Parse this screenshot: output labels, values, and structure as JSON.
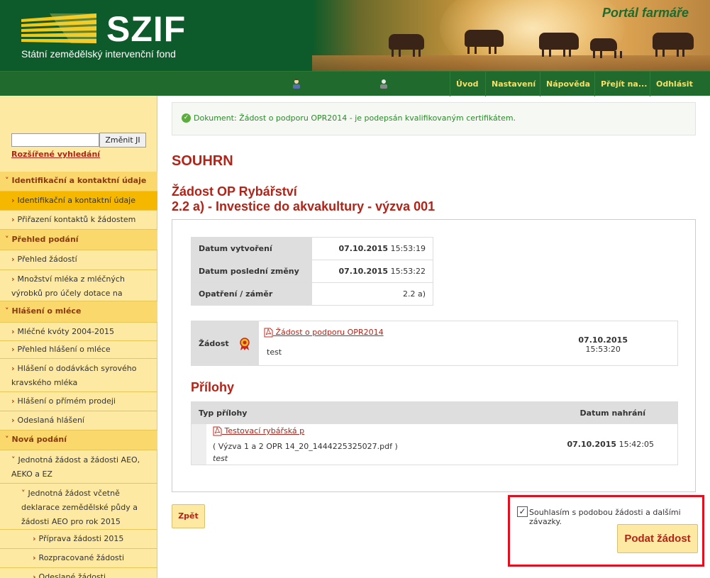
{
  "header": {
    "logo_text": "SZIF",
    "logo_subtitle": "Státní zemědělský intervenční fond",
    "portal_title": "Portál farmáře"
  },
  "topnav": {
    "items": [
      "Úvod",
      "Nastavení",
      "Nápověda",
      "Přejít na...",
      "Odhlásit"
    ]
  },
  "sidebar": {
    "search_button": "Změnit JI",
    "advanced_search": "Rozšířené vyhledání",
    "menu": [
      {
        "label": "Identifikační a kontaktní údaje",
        "type": "section"
      },
      {
        "label": "Identifikační a kontaktní údaje",
        "type": "active"
      },
      {
        "label": "Přiřazení kontaktů k žádostem",
        "type": "item"
      },
      {
        "label": "Přehled podání",
        "type": "section"
      },
      {
        "label": "Přehled žádostí",
        "type": "item"
      },
      {
        "label": "Množství mléka z mléčných výrobků pro účely dotace na dojnice",
        "type": "item"
      },
      {
        "label": "Hlášení o mléce",
        "type": "section"
      },
      {
        "label": "Mléčné kvóty 2004-2015",
        "type": "item"
      },
      {
        "label": "Přehled hlášení o mléce",
        "type": "item"
      },
      {
        "label": "Hlášení o dodávkách syrového kravského mléka",
        "type": "item"
      },
      {
        "label": "Hlášení o přímém prodeji",
        "type": "item"
      },
      {
        "label": "Odeslaná hlášení",
        "type": "item"
      },
      {
        "label": "Nová podání",
        "type": "section"
      },
      {
        "label": "Jednotná žádost a žádosti AEO, AEKO a EZ",
        "type": "item"
      },
      {
        "label": "Jednotná žádost včetně deklarace zemědělské půdy a žádosti AEO pro rok 2015",
        "type": "item"
      },
      {
        "label": "Příprava žádosti 2015",
        "type": "item"
      },
      {
        "label": "Rozpracované žádosti",
        "type": "item"
      },
      {
        "label": "Odeslané žádosti",
        "type": "item"
      }
    ]
  },
  "notice": "Dokument: Žádost o podporu OPR2014 - je podepsán kvalifikovaným certifikátem.",
  "main": {
    "title": "SOUHRN",
    "subtitle_line1": "Žádost OP Rybářství",
    "subtitle_line2": "2.2 a) - Investice do akvakultury - výzva 001",
    "info": [
      {
        "label": "Datum vytvoření",
        "date": "07.10.2015",
        "time": "15:53:19"
      },
      {
        "label": "Datum poslední změny",
        "date": "07.10.2015",
        "time": "15:53:22"
      },
      {
        "label": "Opatření / záměr",
        "date": "",
        "time": "2.2 a)"
      }
    ],
    "document": {
      "label": "Žádost",
      "link": "Žádost o podporu OPR2014",
      "note": "test",
      "date": "07.10.2015",
      "time": "15:53:20"
    },
    "attachments_title": "Přílohy",
    "attachments_header": {
      "type": "Typ přílohy",
      "date": "Datum nahrání"
    },
    "attachments": [
      {
        "link": "Testovací rybářská p",
        "file": "( Výzva 1 a 2 OPR 14_20_1444225325027.pdf )",
        "note": "test",
        "date": "07.10.2015",
        "time": "15:42:05"
      }
    ],
    "back_button": "Zpět",
    "consent_checked": true,
    "consent_text": "Souhlasím s podobou žádosti a dalšími závazky.",
    "submit_button": "Podat žádost"
  },
  "colors": {
    "brand_green": "#1f6a2c",
    "accent_red": "#b32317",
    "sidebar_bg": "#fde9a2",
    "highlight_border": "#e0101e"
  }
}
